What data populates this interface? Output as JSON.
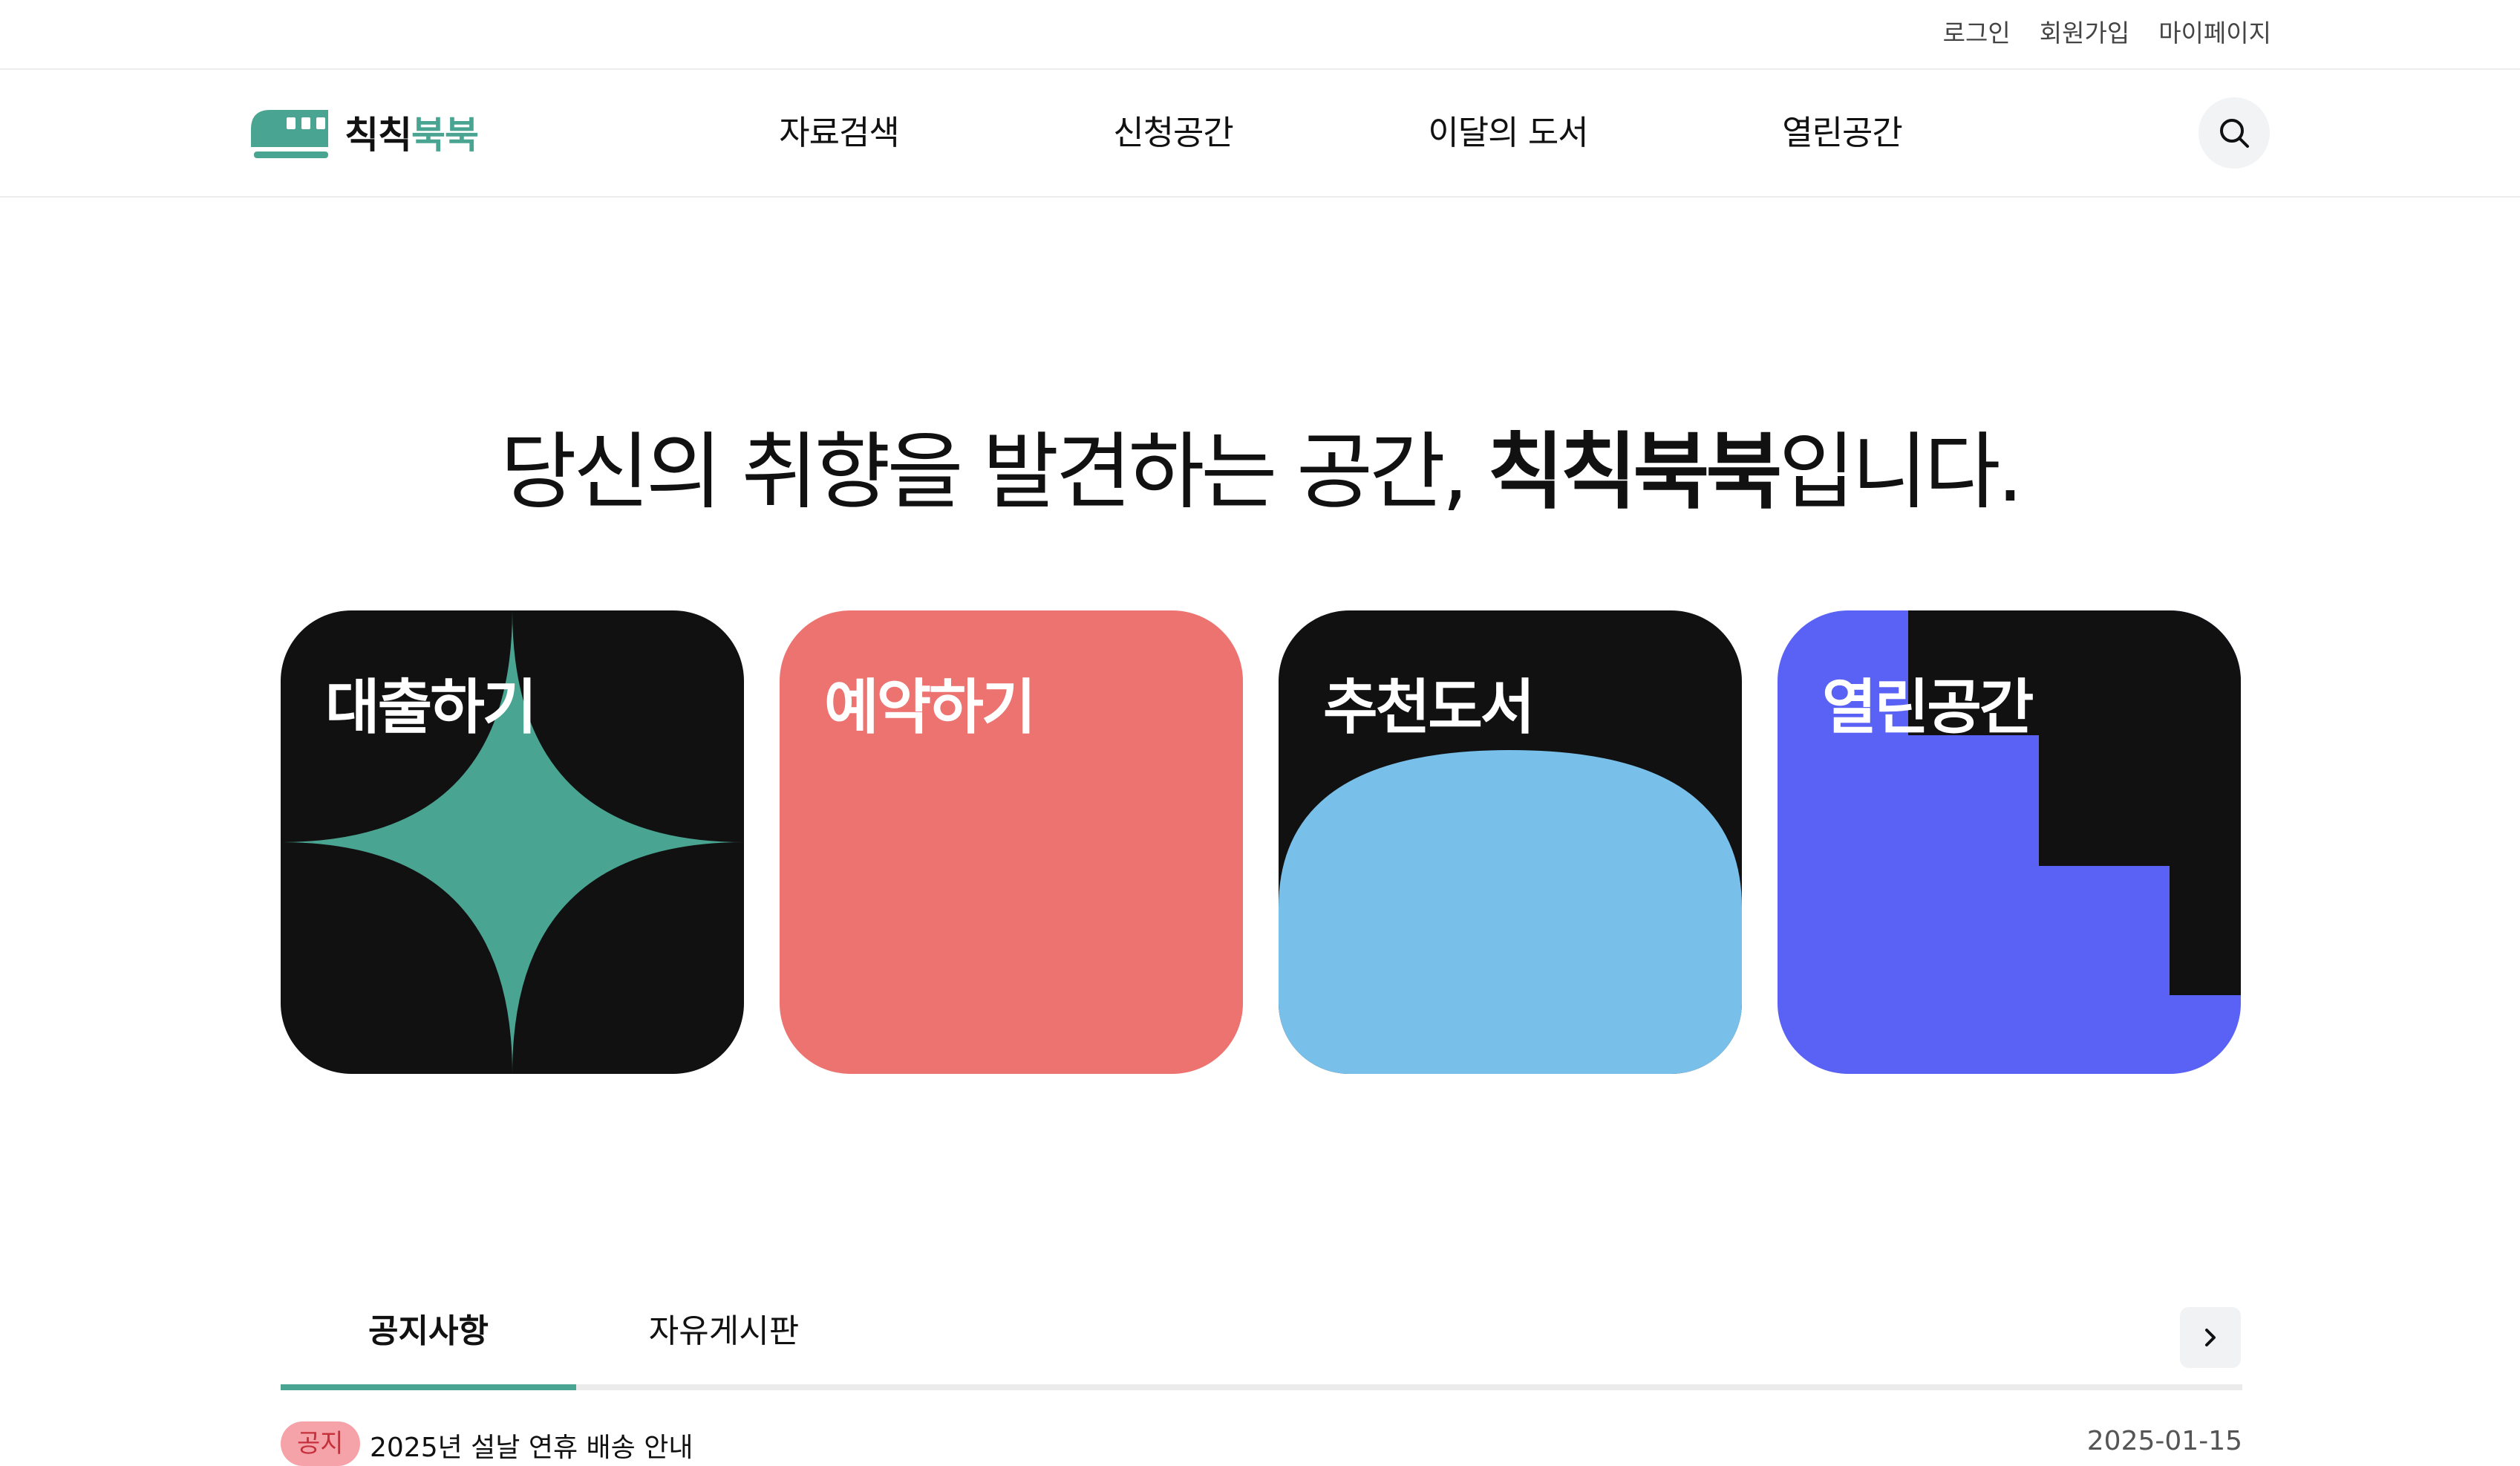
{
  "utility": {
    "links": [
      "로그인",
      "회원가입",
      "마이페이지"
    ]
  },
  "header": {
    "logo": {
      "part1": "칙칙",
      "part2": "북북"
    },
    "nav": [
      "자료검색",
      "신청공간",
      "이달의 도서",
      "열린공간"
    ],
    "search_icon": "search-icon"
  },
  "hero": {
    "title_prefix": "당신의 취향을 발견하는 공간, ",
    "title_strong": "칙칙북북",
    "title_suffix": "입니다."
  },
  "cards": [
    {
      "label": "대출하기",
      "bg": "#111111",
      "accent": "#49a592"
    },
    {
      "label": "예약하기",
      "bg": "#ec7370",
      "accent": "#ec7370"
    },
    {
      "label": "추천도서",
      "bg": "#111111",
      "accent": "#78c0ea"
    },
    {
      "label": "열린공간",
      "bg": "#5962f5",
      "accent": "#111111"
    }
  ],
  "board": {
    "tabs": [
      "공지사항",
      "자유게시판"
    ],
    "active_tab": "공지사항",
    "more_icon": "chevron-right-icon",
    "posts": [
      {
        "badge": "공지",
        "title": "2025년 설날 연휴 배송 안내",
        "date": "2025-01-15"
      }
    ]
  },
  "colors": {
    "brand": "#49a592",
    "border": "#ececec"
  }
}
